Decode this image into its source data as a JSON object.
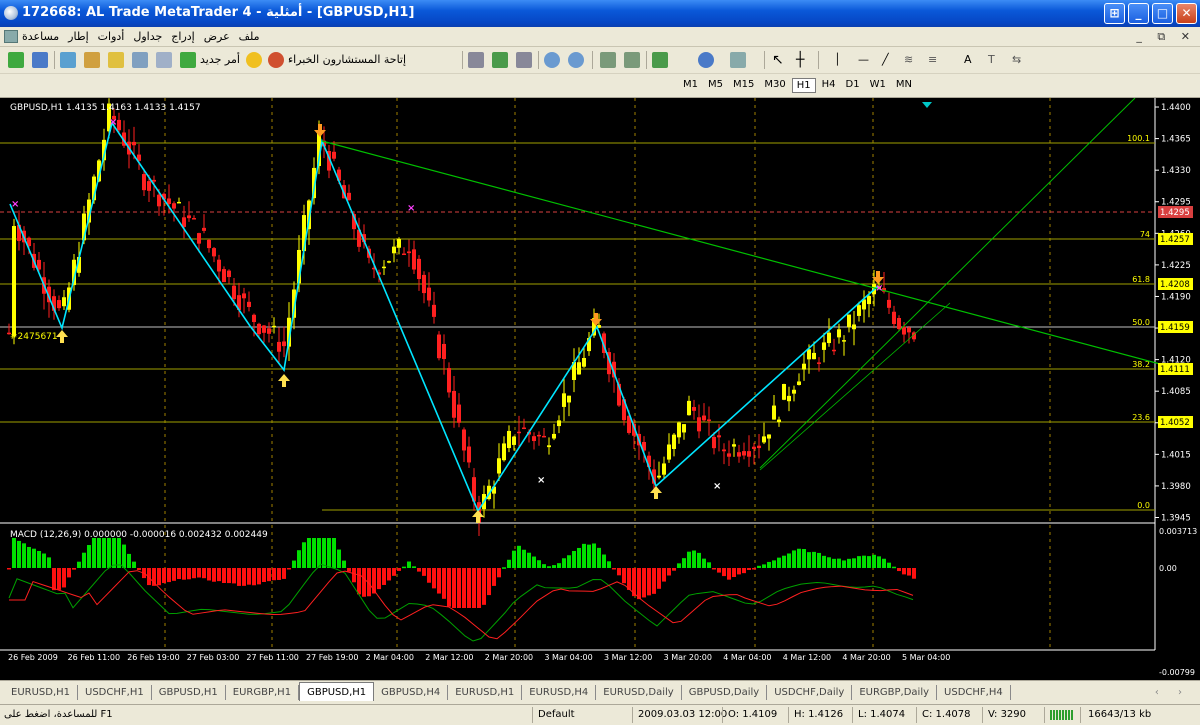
{
  "window": {
    "title": "172668: AL Trade MetaTrader 4 - أمثلية - [GBPUSD,H1]",
    "buttons": {
      "tile": "⊞",
      "minimize": "_",
      "maximize": "□",
      "close": "✕"
    }
  },
  "menu": {
    "items": [
      "ملف",
      "عرض",
      "إدراج",
      "جداول",
      "أدوات",
      "إطار",
      "مساعدة"
    ],
    "mdi_controls": "_ ⧉ ✕"
  },
  "toolbar": {
    "new_order_label": "أمر جديد",
    "experts_label": "إتاحة المستشارون الخبراء",
    "text_tool": "A"
  },
  "timeframes": {
    "items": [
      "M1",
      "M5",
      "M15",
      "M30",
      "H1",
      "H4",
      "D1",
      "W1",
      "MN"
    ],
    "active": "H1"
  },
  "chart": {
    "header": "GBPUSD,H1  1.4135 1.4163 1.4133 1.4157",
    "ticket_label": "#2475671",
    "price_axis": [
      "1.4400",
      "1.4365",
      "1.4330",
      "1.4295",
      "1.4260",
      "1.4225",
      "1.4190",
      "1.4155",
      "1.4120",
      "1.4085",
      "1.4050",
      "1.4015",
      "1.3980",
      "1.3945"
    ],
    "fib_levels": [
      {
        "label": "100.1",
        "price": "1.4365"
      },
      {
        "label": "74",
        "price": "1.4257"
      },
      {
        "label": "61.8",
        "price": "1.4208"
      },
      {
        "label": "50.0",
        "price": "1.4159"
      },
      {
        "label": "38.2",
        "price": "1.4111"
      },
      {
        "label": "23.6",
        "price": "1.4052"
      },
      {
        "label": "0.0",
        "price": ""
      }
    ],
    "price_tags": [
      {
        "value": "1.4295",
        "color": "#d94040",
        "text_color": "#ffffff"
      },
      {
        "value": "1.4257",
        "color": "#ffff00",
        "text_color": "#000000"
      },
      {
        "value": "1.4208",
        "color": "#ffff00",
        "text_color": "#000000"
      },
      {
        "value": "1.4159",
        "color": "#ffff00",
        "text_color": "#000000"
      },
      {
        "value": "1.4111",
        "color": "#ffff00",
        "text_color": "#000000"
      },
      {
        "value": "1.4052",
        "color": "#ffff00",
        "text_color": "#000000"
      }
    ],
    "macd_label": "MACD (12,26,9) 0.000000 -0.000016 0.002432 0.002449",
    "macd_axis": [
      "0.003713",
      "0.00",
      "-0.00799"
    ],
    "time_axis": [
      "26 Feb 2009",
      "26 Feb 11:00",
      "26 Feb 19:00",
      "27 Feb 03:00",
      "27 Feb 11:00",
      "27 Feb 19:00",
      "2 Mar 04:00",
      "2 Mar 12:00",
      "2 Mar 20:00",
      "3 Mar 04:00",
      "3 Mar 12:00",
      "3 Mar 20:00",
      "4 Mar 04:00",
      "4 Mar 12:00",
      "4 Mar 20:00",
      "5 Mar 04:00"
    ],
    "colors": {
      "bull": "#ffff00",
      "bear": "#ff2020",
      "zigzag": "#00e5ff",
      "trend": "#00c000",
      "fib": "#a0a000",
      "grid": "#c8a000"
    }
  },
  "tabs": {
    "items": [
      "EURUSD,H1",
      "USDCHF,H1",
      "GBPUSD,H1",
      "EURGBP,H1",
      "GBPUSD,H1",
      "GBPUSD,H4",
      "EURUSD,H1",
      "EURUSD,H4",
      "EURUSD,Daily",
      "GBPUSD,Daily",
      "USDCHF,Daily",
      "EURGBP,Daily",
      "USDCHF,H4"
    ],
    "active_index": 4,
    "nav": "‹ ›"
  },
  "status": {
    "help": "للمساعدة، اضغط على F1",
    "profile": "Default",
    "datetime": "2009.03.03 12:00",
    "open": "O: 1.4109",
    "high": "H: 1.4126",
    "low": "L: 1.4074",
    "close": "C: 1.4078",
    "volume": "V: 3290",
    "traffic": "16643/13 kb"
  }
}
